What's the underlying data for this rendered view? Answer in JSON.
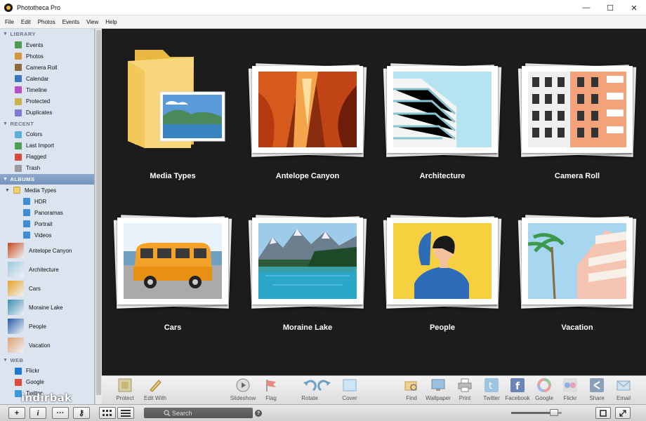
{
  "window": {
    "title": "Phototheca Pro",
    "controls": [
      "—",
      "☐",
      "✕"
    ]
  },
  "menu": [
    "File",
    "Edit",
    "Photos",
    "Events",
    "View",
    "Help"
  ],
  "sidebar": {
    "library": {
      "header": "LIBRARY",
      "items": [
        {
          "label": "Events",
          "icon": "events-icon",
          "color": "#4d9a4a"
        },
        {
          "label": "Photos",
          "icon": "photos-icon",
          "color": "#d49a3a"
        },
        {
          "label": "Camera Roll",
          "icon": "camera-roll-icon",
          "color": "#8b6a3c"
        },
        {
          "label": "Calendar",
          "icon": "calendar-icon",
          "color": "#3b78c4"
        },
        {
          "label": "Timeline",
          "icon": "timeline-icon",
          "color": "#b84bc6"
        },
        {
          "label": "Protected",
          "icon": "protected-icon",
          "color": "#c9b24a"
        },
        {
          "label": "Duplicates",
          "icon": "duplicates-icon",
          "color": "#7a7ad0"
        }
      ]
    },
    "recent": {
      "header": "RECENT",
      "items": [
        {
          "label": "Colors",
          "icon": "colors-icon",
          "color": "#5ab0d8"
        },
        {
          "label": "Last Import",
          "icon": "last-import-icon",
          "color": "#4aa050"
        },
        {
          "label": "Flagged",
          "icon": "flag-icon",
          "color": "#d84a3a"
        },
        {
          "label": "Trash",
          "icon": "trash-icon",
          "color": "#9a9a9a"
        }
      ]
    },
    "albums": {
      "header": "ALBUMS",
      "folder": "Media Types",
      "subitems": [
        "HDR",
        "Panoramas",
        "Portrait",
        "Videos"
      ],
      "items": [
        {
          "label": "Antelope Canyon",
          "color": "#c8481c"
        },
        {
          "label": "Architecture",
          "color": "#9cc8d8"
        },
        {
          "label": "Cars",
          "color": "#e8a020"
        },
        {
          "label": "Moraine Lake",
          "color": "#3a8cb0"
        },
        {
          "label": "People",
          "color": "#2a5ca8"
        },
        {
          "label": "Vacation",
          "color": "#e0a070"
        }
      ]
    },
    "web": {
      "header": "WEB",
      "items": [
        {
          "label": "Flickr",
          "icon": "flickr-icon",
          "color": "#1a7ad8"
        },
        {
          "label": "Google",
          "icon": "google-icon",
          "color": "#e04a3a"
        },
        {
          "label": "Twitter",
          "icon": "twitter-icon",
          "color": "#3a9ae0"
        }
      ]
    }
  },
  "grid": [
    {
      "label": "Media Types",
      "type": "folder"
    },
    {
      "label": "Antelope Canyon",
      "type": "canyon"
    },
    {
      "label": "Architecture",
      "type": "architecture"
    },
    {
      "label": "Camera Roll",
      "type": "building"
    },
    {
      "label": "Cars",
      "type": "cars"
    },
    {
      "label": "Moraine Lake",
      "type": "lake"
    },
    {
      "label": "People",
      "type": "people"
    },
    {
      "label": "Vacation",
      "type": "vacation"
    }
  ],
  "toolbar": {
    "protect": "Protect",
    "edit_with": "Edit With",
    "slideshow": "Slideshow",
    "flag": "Flag",
    "rotate": "Rotate",
    "cover": "Cover",
    "find": "Find",
    "wallpaper": "Wallpaper",
    "print": "Print",
    "twitter": "Twitter",
    "facebook": "Facebook",
    "google": "Google",
    "flickr": "Flickr",
    "share": "Share",
    "email": "Email"
  },
  "statusbar": {
    "add": "+",
    "info": "i",
    "more": "···",
    "key": "⚷",
    "search_placeholder": "Search",
    "help": "?",
    "zoom_level": 0.85
  },
  "watermark": "indirbak"
}
